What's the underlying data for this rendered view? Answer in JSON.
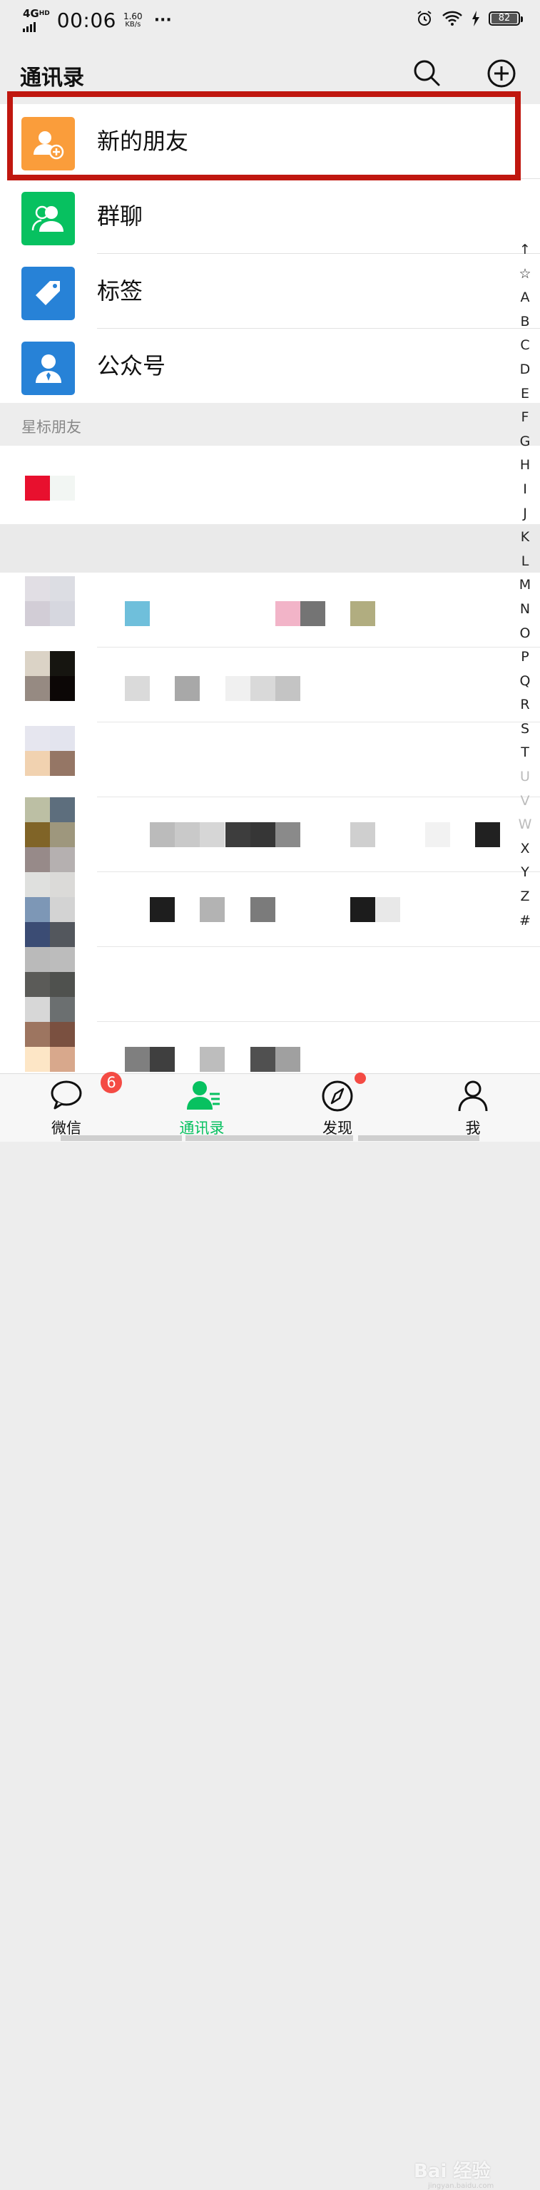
{
  "status_bar": {
    "network": "4G",
    "network_sup": "HD",
    "time": "00:06",
    "speed_value": "1.60",
    "speed_unit": "KB/s",
    "more": "···",
    "battery": "82"
  },
  "header": {
    "title": "通讯录"
  },
  "menu": {
    "items": [
      {
        "label": "新的朋友",
        "icon": "add-friend-icon",
        "color": "#fa9d3b"
      },
      {
        "label": "群聊",
        "icon": "group-chat-icon",
        "color": "#07c160"
      },
      {
        "label": "标签",
        "icon": "tag-icon",
        "color": "#2782d7"
      },
      {
        "label": "公众号",
        "icon": "official-account-icon",
        "color": "#2782d7"
      }
    ]
  },
  "sections": {
    "starred": "星标朋友"
  },
  "alphabet_index": [
    "↑",
    "☆",
    "A",
    "B",
    "C",
    "D",
    "E",
    "F",
    "G",
    "H",
    "I",
    "J",
    "K",
    "L",
    "M",
    "N",
    "O",
    "P",
    "Q",
    "R",
    "S",
    "T",
    "U",
    "V",
    "W",
    "X",
    "Y",
    "Z",
    "#"
  ],
  "tabs": [
    {
      "label": "微信",
      "icon": "chat-icon",
      "badge": "6"
    },
    {
      "label": "通讯录",
      "icon": "contacts-icon"
    },
    {
      "label": "发现",
      "icon": "compass-icon"
    },
    {
      "label": "我",
      "icon": "profile-icon"
    }
  ],
  "colors": {
    "accent": "#07c160",
    "highlight_border": "#c0170f",
    "badge": "#f44b44"
  },
  "watermark": {
    "text": "Bai 经验",
    "sub": "jingyan.baidu.com"
  }
}
